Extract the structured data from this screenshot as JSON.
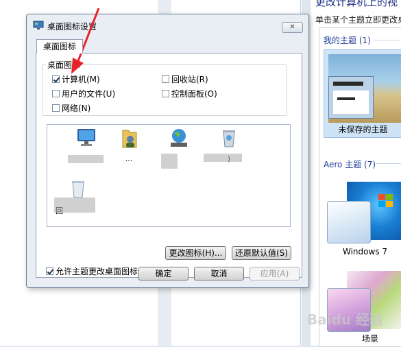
{
  "dialog": {
    "title": "桌面图标设置",
    "close_glyph": "✕",
    "tab_label": "桌面图标",
    "group_title": "桌面图标",
    "checkboxes": [
      {
        "label": "计算机(M)",
        "checked": true
      },
      {
        "label": "回收站(R)",
        "checked": false
      },
      {
        "label": "用户的文件(U)",
        "checked": false
      },
      {
        "label": "控制面板(O)",
        "checked": false
      },
      {
        "label": "网络(N)",
        "checked": false
      }
    ],
    "icons": [
      {
        "name": "computer",
        "label": ""
      },
      {
        "name": "user-files",
        "label": "..."
      },
      {
        "name": "network",
        "label": ""
      },
      {
        "name": "recycle-bin-full",
        "label": ")"
      },
      {
        "name": "recycle-bin-empty",
        "label": "回"
      }
    ],
    "change_icon_button": "更改图标(H)...",
    "restore_default_button": "还原默认值(S)",
    "allow_themes_label": "允许主题更改桌面图标(L)",
    "allow_themes_checked": true,
    "ok_button": "确定",
    "cancel_button": "取消",
    "apply_button": "应用(A)"
  },
  "theme_panel": {
    "heading": "更改计算机上的视",
    "subheading": "单击某个主题立即更改桌",
    "my_themes_label": "我的主题 (1)",
    "unsaved_theme_label": "未保存的主题",
    "aero_label": "Aero 主题 (7)",
    "windows7_label": "Windows 7",
    "scene_label": "场景",
    "watermark": "Baidu 经验"
  },
  "colors": {
    "annotation_arrow": "#e8242b",
    "link_blue": "#1e3c96",
    "dialog_bg": "#e9eef5"
  }
}
